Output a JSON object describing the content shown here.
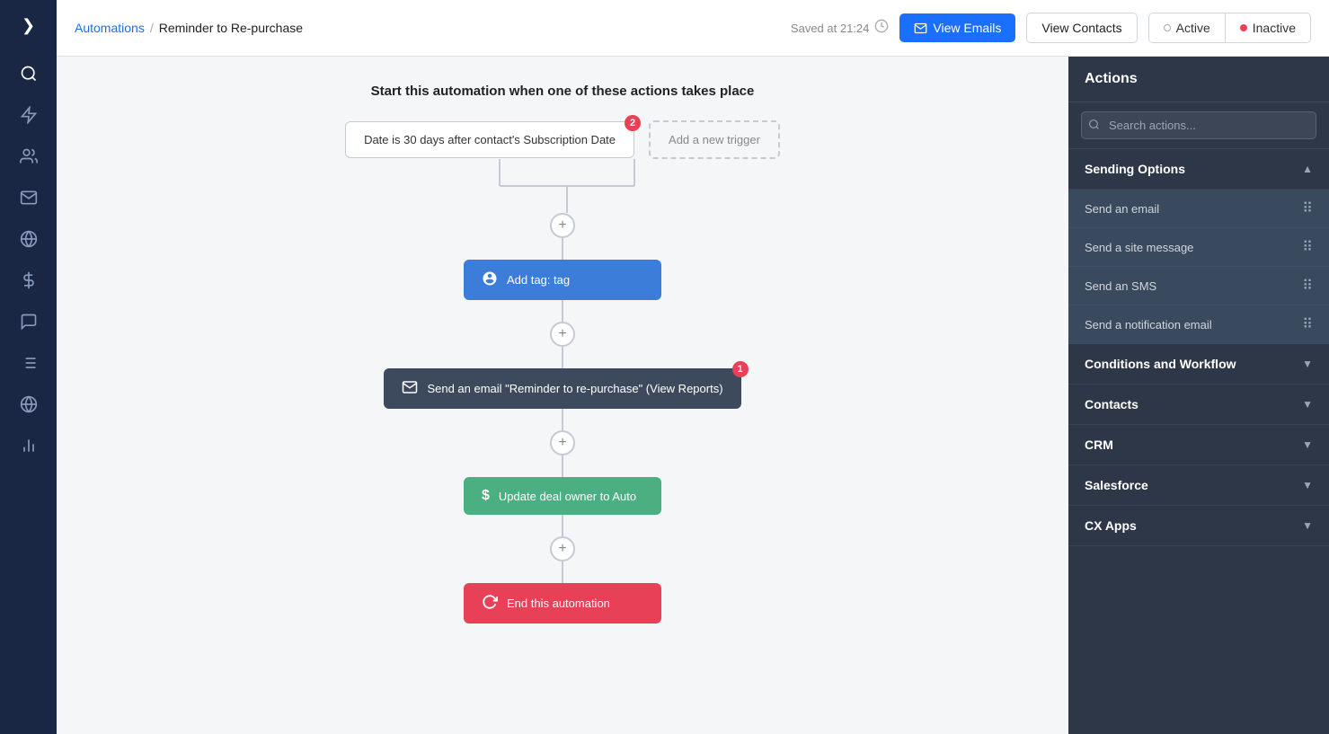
{
  "sidebar": {
    "items": [
      {
        "name": "toggle",
        "icon": "❯",
        "label": "Toggle sidebar"
      },
      {
        "name": "search",
        "icon": "🔍",
        "label": "Search"
      },
      {
        "name": "lightning",
        "icon": "⚡",
        "label": "Automations"
      },
      {
        "name": "contacts",
        "icon": "👥",
        "label": "Contacts"
      },
      {
        "name": "email",
        "icon": "✉",
        "label": "Emails"
      },
      {
        "name": "analytics",
        "icon": "📊",
        "label": "Analytics"
      },
      {
        "name": "deals",
        "icon": "💰",
        "label": "Deals"
      },
      {
        "name": "messages",
        "icon": "💬",
        "label": "Messages"
      },
      {
        "name": "lists",
        "icon": "☰",
        "label": "Lists"
      },
      {
        "name": "globe",
        "icon": "🌐",
        "label": "Website"
      },
      {
        "name": "reports",
        "icon": "📈",
        "label": "Reports"
      }
    ]
  },
  "topbar": {
    "breadcrumb_parent": "Automations",
    "breadcrumb_current": "Reminder to Re-purchase",
    "saved_text": "Saved at 21:24",
    "view_emails_label": "View Emails",
    "view_contacts_label": "View Contacts",
    "status_active": "Active",
    "status_inactive": "Inactive"
  },
  "canvas": {
    "title": "Start this automation when one of these actions takes place",
    "trigger1_label": "Date is 30 days after contact's Subscription Date",
    "trigger1_badge": "2",
    "trigger2_label": "Add a new trigger",
    "nodes": [
      {
        "id": "tag",
        "label": "Add tag: tag",
        "type": "tag",
        "icon": "👤"
      },
      {
        "id": "email",
        "label": "Send an email \"Reminder to re-purchase\" (View Reports)",
        "type": "email",
        "icon": "✉",
        "badge": "1"
      },
      {
        "id": "deal",
        "label": "Update deal owner to Auto",
        "type": "deal",
        "icon": "$"
      },
      {
        "id": "end",
        "label": "End this automation",
        "type": "end",
        "icon": "↺"
      }
    ]
  },
  "right_panel": {
    "title": "Actions",
    "search_placeholder": "Search actions...",
    "sections": [
      {
        "id": "sending",
        "label": "Sending Options",
        "expanded": true,
        "items": [
          {
            "label": "Send an email"
          },
          {
            "label": "Send a site message"
          },
          {
            "label": "Send an SMS"
          },
          {
            "label": "Send a notification email"
          }
        ]
      },
      {
        "id": "conditions",
        "label": "Conditions and Workflow",
        "expanded": false,
        "items": []
      },
      {
        "id": "contacts",
        "label": "Contacts",
        "expanded": false,
        "items": []
      },
      {
        "id": "crm",
        "label": "CRM",
        "expanded": false,
        "items": []
      },
      {
        "id": "salesforce",
        "label": "Salesforce",
        "expanded": false,
        "items": []
      },
      {
        "id": "cxapps",
        "label": "CX Apps",
        "expanded": false,
        "items": []
      }
    ]
  }
}
